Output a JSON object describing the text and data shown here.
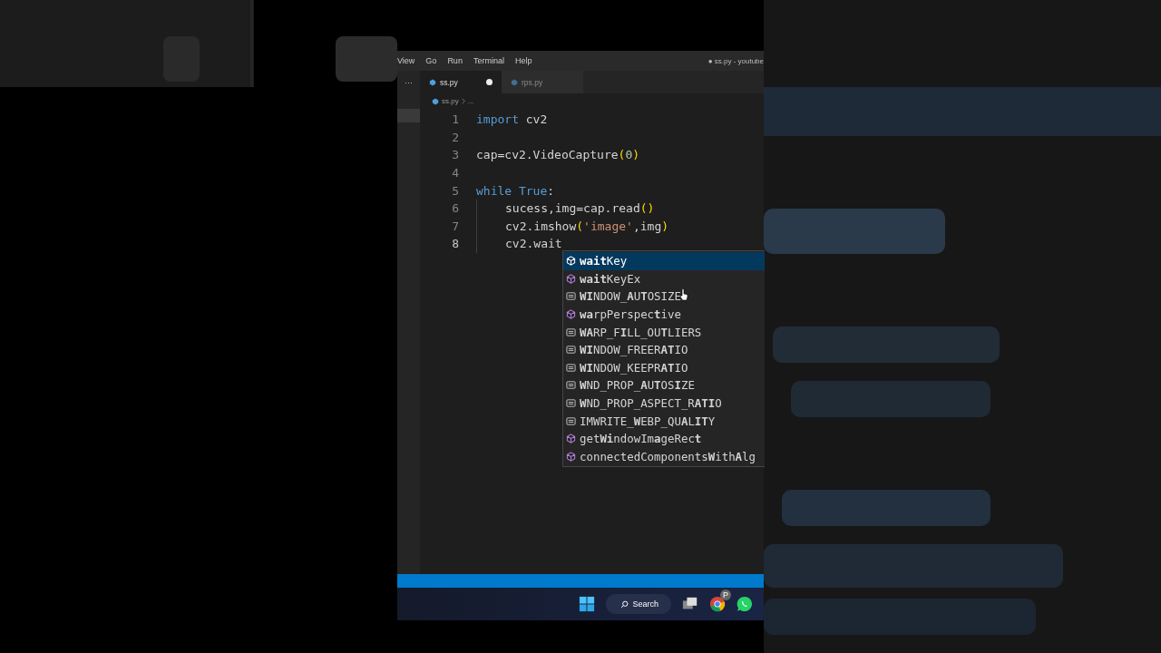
{
  "menu": [
    "View",
    "Go",
    "Run",
    "Terminal",
    "Help"
  ],
  "window": {
    "title": "● ss.py - youtube"
  },
  "tabs": [
    {
      "label": "ss.py",
      "selected": true,
      "modified": true
    },
    {
      "label": "rps.py",
      "selected": false,
      "modified": false
    }
  ],
  "more": "···",
  "breadcrumb": [
    "ss.py",
    "..."
  ],
  "lines": [
    {
      "number": "1",
      "current": false,
      "indent": false,
      "tokens": [
        {
          "kind": "keyword",
          "text": "import"
        },
        {
          "kind": "plain",
          "text": " cv2"
        }
      ]
    },
    {
      "number": "2",
      "current": false,
      "indent": false
    },
    {
      "number": "3",
      "current": false,
      "indent": false,
      "tokens": [
        {
          "kind": "plain",
          "text": "cap=cv2.VideoCapture"
        },
        {
          "kind": "paren",
          "text": "("
        },
        {
          "kind": "number",
          "text": "0"
        },
        {
          "kind": "paren",
          "text": ")"
        }
      ]
    },
    {
      "number": "4",
      "current": false,
      "indent": false
    },
    {
      "number": "5",
      "current": false,
      "indent": false,
      "tokens": [
        {
          "kind": "keyword",
          "text": "while True"
        },
        {
          "kind": "plain",
          "text": ":"
        }
      ]
    },
    {
      "number": "6",
      "current": false,
      "indent": true,
      "tokens": [
        {
          "kind": "plain",
          "text": "sucess,img=cap.read"
        },
        {
          "kind": "paren",
          "text": "()"
        }
      ]
    },
    {
      "number": "7",
      "current": false,
      "indent": true,
      "tokens": [
        {
          "kind": "plain",
          "text": "cv2.imshow"
        },
        {
          "kind": "paren",
          "text": "("
        },
        {
          "kind": "string",
          "text": "'image'"
        },
        {
          "kind": "plain",
          "text": ",img"
        },
        {
          "kind": "paren",
          "text": ")"
        }
      ]
    },
    {
      "number": "8",
      "current": true,
      "indent": true,
      "tokens": [
        {
          "kind": "plain",
          "text": "cv2.wait"
        }
      ]
    }
  ],
  "suggestions": [
    {
      "kind": "method",
      "label": "**wait**Key",
      "selected": true
    },
    {
      "kind": "method",
      "label": "**wait**KeyEx",
      "selected": false
    },
    {
      "kind": "constant",
      "label": "**WI**NDOW_**A**U**T**OSIZE",
      "selected": false
    },
    {
      "kind": "method",
      "label": "**wa**rpPerspec**t**ive",
      "selected": false
    },
    {
      "kind": "constant",
      "label": "**WA**RP_F**I**LL_OU**T**LIERS",
      "selected": false
    },
    {
      "kind": "constant",
      "label": "**WI**NDOW_FREER**AT**IO",
      "selected": false
    },
    {
      "kind": "constant",
      "label": "**WI**NDOW_KEEPR**AT**IO",
      "selected": false
    },
    {
      "kind": "constant",
      "label": "**W**ND_PROP_**A**U**T**OS**I**ZE",
      "selected": false
    },
    {
      "kind": "constant",
      "label": "**W**ND_PROP_ASPECT_R**ATI**O",
      "selected": false
    },
    {
      "kind": "constant",
      "label": "IMWRITE_**W**EBP_QU**A**L**IT**Y",
      "selected": false
    },
    {
      "kind": "method",
      "label": "get**Wi**ndowIm**a**geRec**t**",
      "selected": false
    },
    {
      "kind": "method",
      "label": "connectedComponents**W**ith**A**lg",
      "selected": false
    }
  ],
  "taskbar": {
    "search": "Search",
    "badge": "P"
  }
}
